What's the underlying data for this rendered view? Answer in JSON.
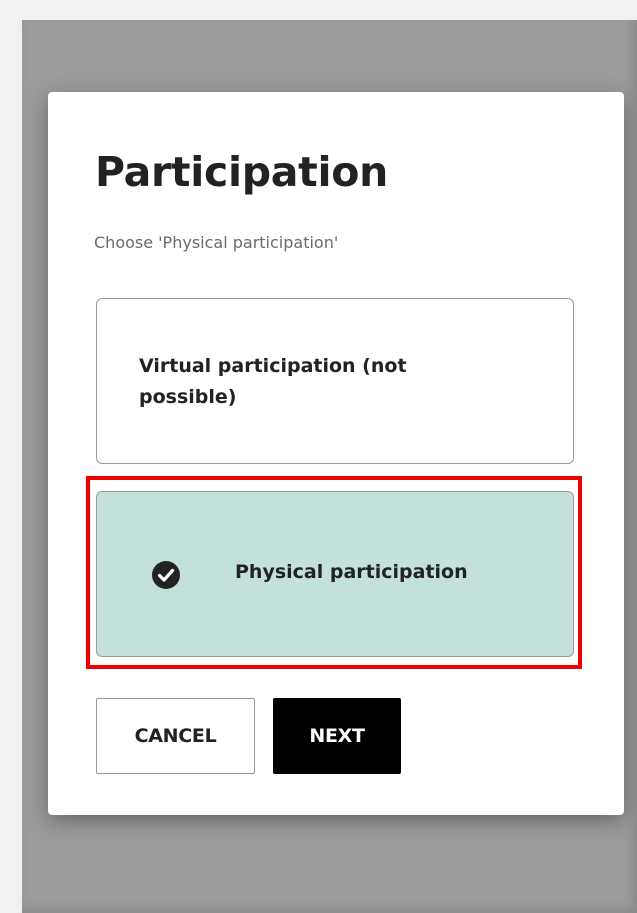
{
  "dialog": {
    "title": "Participation",
    "subtitle": "Choose 'Physical participation'",
    "options": [
      {
        "label": "Virtual participation (not possible)",
        "selected": false
      },
      {
        "label": "Physical participation",
        "selected": true,
        "icon": "check-circle-icon"
      }
    ],
    "buttons": {
      "cancel_label": "CANCEL",
      "next_label": "NEXT"
    }
  },
  "colors": {
    "overlay": "#9c9c9c",
    "selected_option_bg": "#c3e0da",
    "highlight_border": "#ee0000",
    "primary_button_bg": "#000000"
  }
}
